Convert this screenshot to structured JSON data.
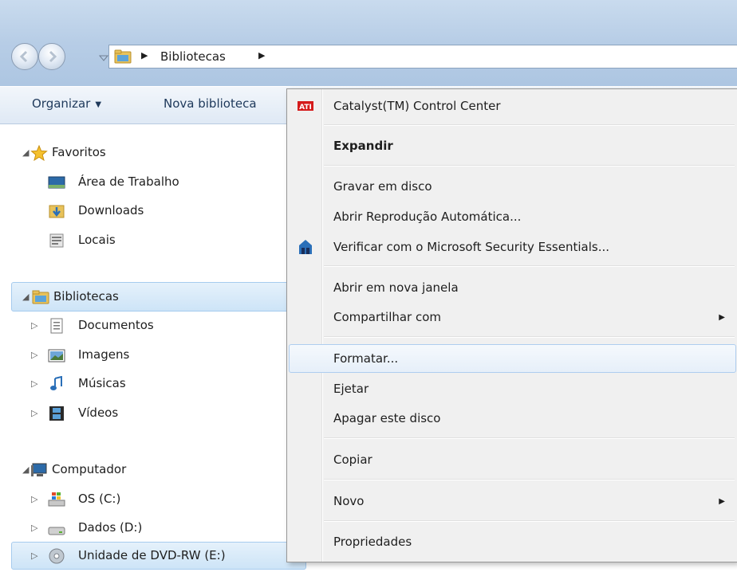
{
  "address": {
    "crumb": "Bibliotecas"
  },
  "toolbar": {
    "organize": "Organizar",
    "new_library": "Nova biblioteca"
  },
  "nav": {
    "favorites": "Favoritos",
    "desktop": "Área de Trabalho",
    "downloads": "Downloads",
    "places": "Locais",
    "libraries": "Bibliotecas",
    "documents": "Documentos",
    "pictures": "Imagens",
    "music": "Músicas",
    "videos": "Vídeos",
    "computer": "Computador",
    "drive_c": "OS (C:)",
    "drive_d": "Dados (D:)",
    "drive_e": "Unidade de DVD-RW (E:)"
  },
  "menu": {
    "catalyst": "Catalyst(TM) Control Center",
    "expand": "Expandir",
    "burn": "Gravar em disco",
    "autoplay": "Abrir Reprodução Automática...",
    "scan": "Verificar com o Microsoft Security Essentials...",
    "new_window": "Abrir em nova janela",
    "share": "Compartilhar com",
    "format": "Formatar...",
    "eject": "Ejetar",
    "erase": "Apagar este disco",
    "copy": "Copiar",
    "new": "Novo",
    "properties": "Propriedades"
  },
  "icons": {
    "ati_logo_text": "ATI"
  },
  "colors": {
    "titlebar": "#b7cde6",
    "selection": "#cde4f7",
    "menu_bg": "#f0f0f0",
    "ati_red": "#d51b1b"
  }
}
